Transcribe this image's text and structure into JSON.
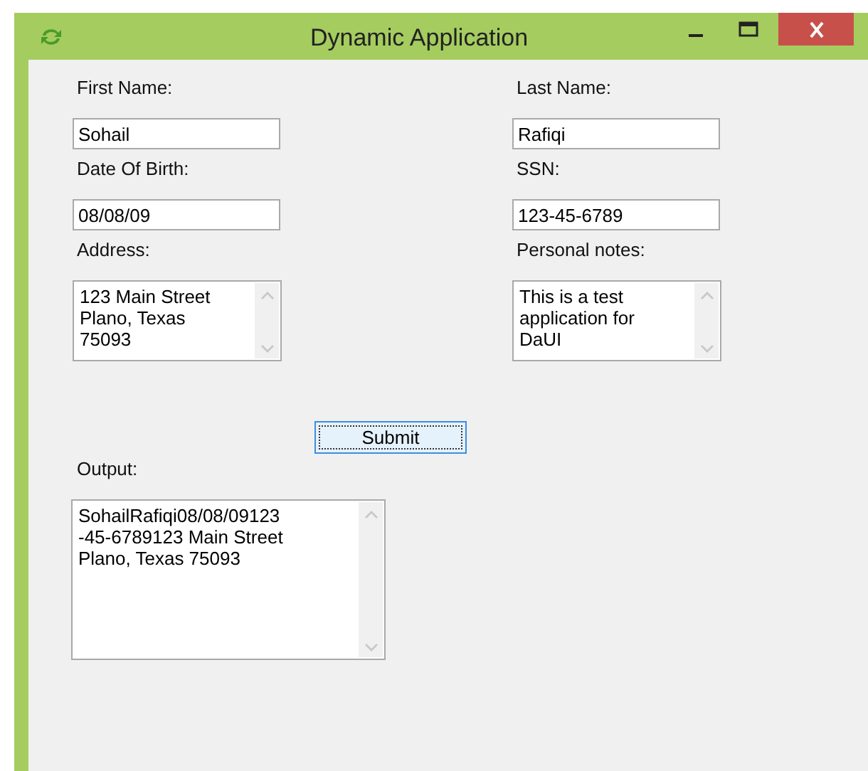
{
  "window": {
    "title": "Dynamic Application"
  },
  "fields": [
    {
      "label": "First Name:",
      "value": "Sohail",
      "kind": "text"
    },
    {
      "label": "Last Name:",
      "value": "Rafiqi",
      "kind": "text"
    },
    {
      "label": "Date Of Birth:",
      "value": "08/08/09",
      "kind": "text"
    },
    {
      "label": "SSN:",
      "value": "123-45-6789",
      "kind": "text"
    },
    {
      "label": "Address:",
      "lines": [
        "123 Main Street",
        "Plano, Texas",
        "75093"
      ],
      "kind": "multiline"
    },
    {
      "label": "Personal notes:",
      "lines": [
        "This is a test",
        "application for",
        "DaUI"
      ],
      "kind": "multiline"
    }
  ],
  "submit": {
    "label": "Submit",
    "focused": true
  },
  "output": {
    "label": "Output:",
    "lines": [
      "SohailRafiqi08/08/09123",
      "-45-6789123 Main Street",
      "Plano, Texas 75093"
    ]
  }
}
